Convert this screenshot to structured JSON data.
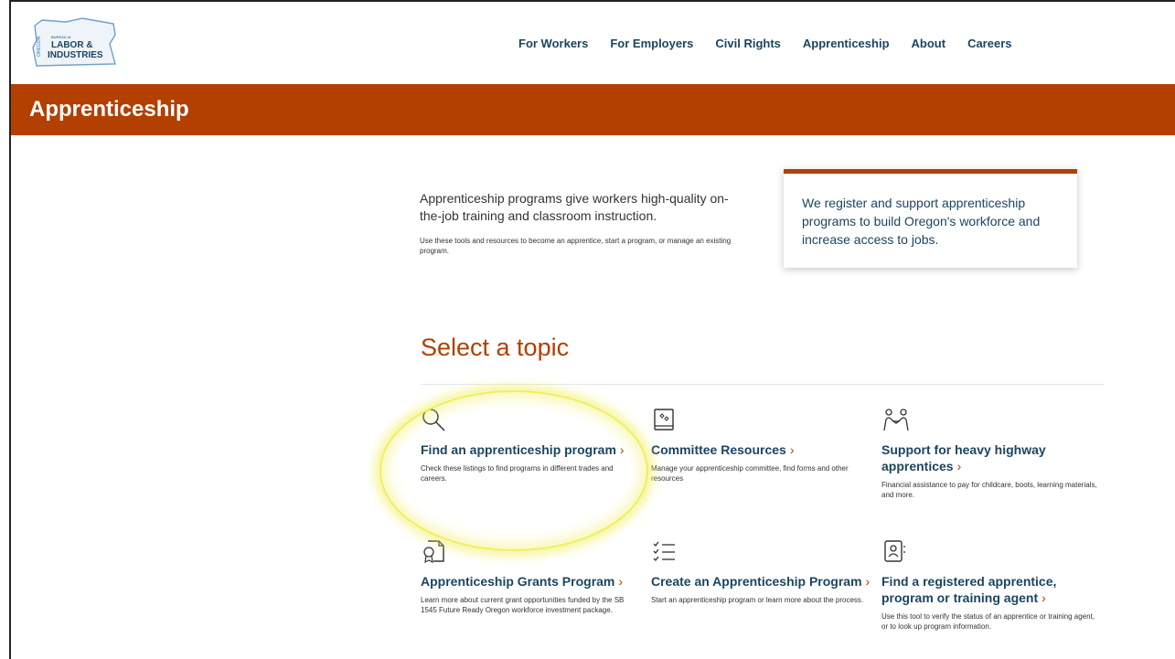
{
  "logo": {
    "state": "OREGON",
    "line1": "BUREAU of",
    "line2": "LABOR &",
    "line3": "INDUSTRIES"
  },
  "nav": {
    "items": [
      "For Workers",
      "For Employers",
      "Civil Rights",
      "Apprenticeship",
      "About",
      "Careers"
    ]
  },
  "banner": {
    "title": "Apprenticeship"
  },
  "intro": {
    "lead": "Apprenticeship programs give workers high-quality on-the-job training and classroom instruction.",
    "sub": "Use these tools and resources to become an apprentice, start a program, or manage an existing program."
  },
  "callout": {
    "text": "We register and support apprenticeship programs to build Oregon's workforce and increase access to jobs."
  },
  "topics": {
    "heading": "Select a topic",
    "chevron": "›",
    "cards": [
      {
        "icon": "search-icon",
        "title": "Find an apprenticeship program",
        "desc": "Check these listings to find programs in different trades and careers."
      },
      {
        "icon": "book-icon",
        "title": "Committee Resources",
        "desc": "Manage your apprenticeship committee, find forms and other resources"
      },
      {
        "icon": "people-icon",
        "title": "Support for heavy highway apprentices",
        "desc": "Financial assistance to pay for childcare, boots, learning materials, and more."
      },
      {
        "icon": "certificate-icon",
        "title": "Apprenticeship Grants Program",
        "desc": "Learn more about current grant opportunities funded by the SB 1545 Future Ready Oregon workforce investment package."
      },
      {
        "icon": "checklist-icon",
        "title": "Create an Apprenticeship Program",
        "desc": "Start an apprenticeship program or learn more about the process."
      },
      {
        "icon": "contact-book-icon",
        "title": "Find a registered apprentice, program or training agent",
        "desc": "Use this tool to verify the status of an apprentice or training agent, or to look up program information."
      }
    ]
  },
  "colors": {
    "brand": "#b33f00",
    "link": "#1b4560",
    "highlight": "#f1ee5a"
  }
}
